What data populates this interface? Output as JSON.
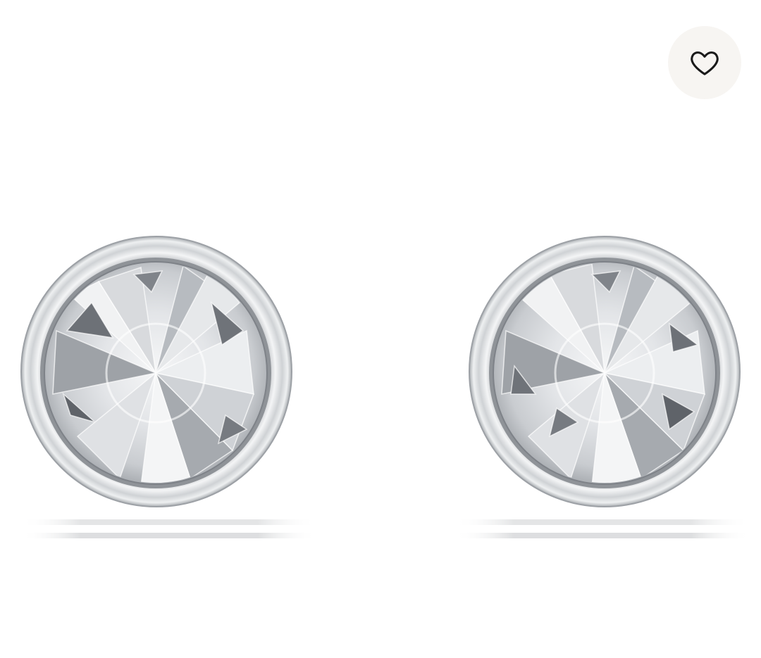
{
  "product": {
    "image_subject": "crystal-stud-earrings",
    "metal_color": "#d9dbdd",
    "crystal_color": "#e9ebee"
  },
  "wishlist": {
    "icon": "heart-outline-icon",
    "background_color": "#f7f5f2",
    "icon_color": "#1a1a1a"
  }
}
